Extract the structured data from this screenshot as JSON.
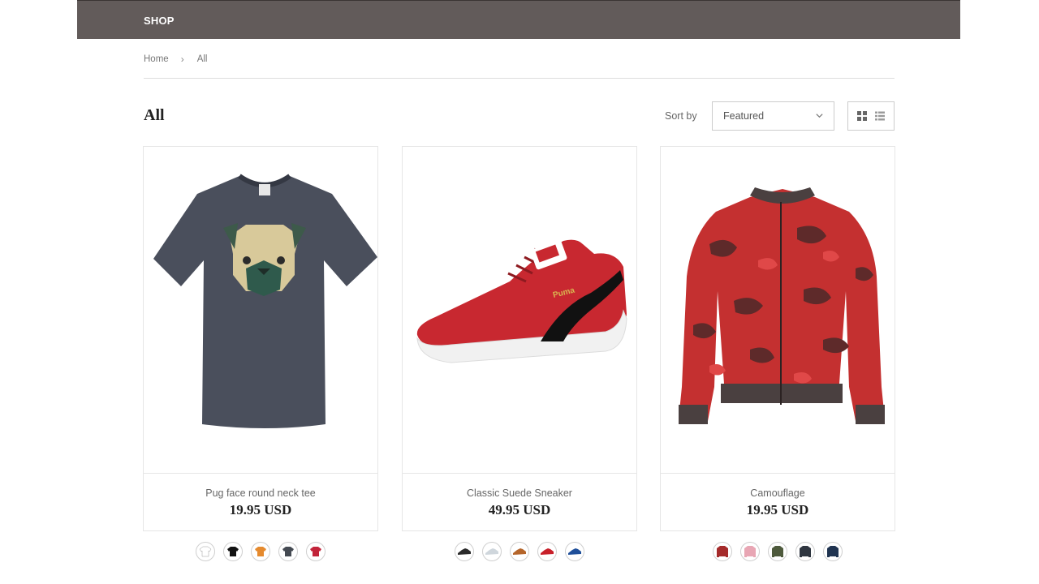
{
  "header": {
    "nav_item": "SHOP"
  },
  "breadcrumb": {
    "home": "Home",
    "separator": "›",
    "current": "All"
  },
  "collection": {
    "title": "All"
  },
  "sort": {
    "label": "Sort by",
    "selected": "Featured"
  },
  "view": {
    "active": "grid"
  },
  "products": [
    {
      "name": "Pug face round neck tee",
      "price": "19.95 USD",
      "image": "pug-tshirt-image",
      "swatch_colors": [
        "#ffffff",
        "#111111",
        "#e58a2e",
        "#444a52",
        "#c2243a"
      ]
    },
    {
      "name": "Classic Suede Sneaker",
      "price": "49.95 USD",
      "image": "red-sneaker-image",
      "swatch_colors": [
        "#2a2a2a",
        "#cfd6dc",
        "#b5652b",
        "#c8202a",
        "#1f4f9a"
      ]
    },
    {
      "name": "Camouflage",
      "price": "19.95 USD",
      "image": "camo-jacket-image",
      "swatch_colors": [
        "#a42a2a",
        "#e8a6b4",
        "#4e5a3c",
        "#2f3640",
        "#1f3350"
      ]
    }
  ],
  "colors": {
    "topbar": "#625b5a",
    "border": "#e6e6e6"
  }
}
